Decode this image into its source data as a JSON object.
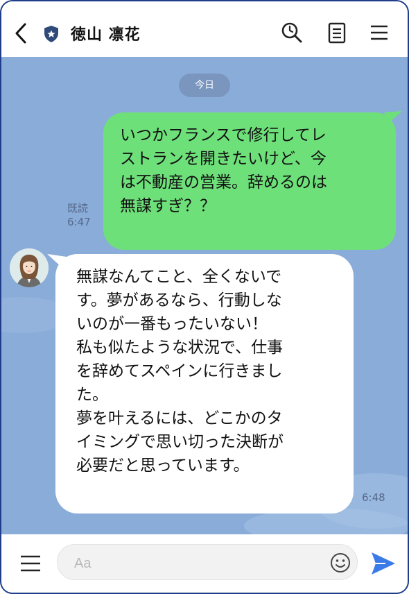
{
  "header": {
    "back_icon": "chevron-left-icon",
    "badge_icon": "shield-star-icon",
    "contact_name": "徳山 凛花",
    "actions": [
      "search-icon",
      "notes-icon",
      "menu-icon"
    ]
  },
  "chat": {
    "date_divider": "今日",
    "messages": [
      {
        "sender": "me",
        "text": "いつかフランスで修行してレ\nストランを開きたいけど、今\nは不動産の営業。辞めるのは\n無謀すぎ？？",
        "read_label": "既読",
        "time": "6:47"
      },
      {
        "sender": "contact",
        "text": "無謀なんてこと、全くないで\nす。夢があるなら、行動しな\nいのが一番もったいない！\n私も似たような状況で、仕事\nを辞めてスペインに行きまし\nた。\n夢を叶えるには、どこかのタ\nイミングで思い切った決断が\n必要だと思っています。",
        "time": "6:48"
      }
    ]
  },
  "input_bar": {
    "placeholder": "Aa",
    "value": ""
  },
  "colors": {
    "chat_background": "#8aacd8",
    "outgoing_bubble": "#6ee07a",
    "incoming_bubble": "#ffffff",
    "send_button": "#3a7be8",
    "frame_border": "#1f3d8a"
  }
}
